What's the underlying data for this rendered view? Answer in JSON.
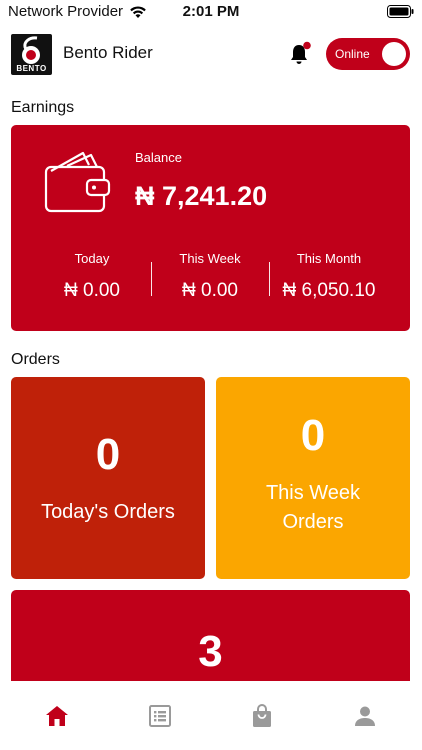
{
  "status_bar": {
    "carrier": "Network Provider",
    "time": "2:01 PM"
  },
  "header": {
    "logo_text": "BENTO",
    "app_title": "Bento Rider",
    "status_toggle_label": "Online",
    "toggle_on": true
  },
  "earnings": {
    "section_title": "Earnings",
    "balance_label": "Balance",
    "balance_value": "₦ 7,241.20",
    "periods": [
      {
        "label": "Today",
        "value": "₦ 0.00"
      },
      {
        "label": "This Week",
        "value": "₦ 0.00"
      },
      {
        "label": "This Month",
        "value": "₦ 6,050.10"
      }
    ]
  },
  "orders": {
    "section_title": "Orders",
    "tiles": [
      {
        "value": "0",
        "label": "Today's Orders",
        "color": "#bf2109"
      },
      {
        "value": "0",
        "label": "This Week Orders",
        "color": "#fba600"
      },
      {
        "value": "3",
        "label": "",
        "color": "#c0001a"
      }
    ]
  },
  "bottom_nav": {
    "items": [
      {
        "icon": "home-icon",
        "active": true
      },
      {
        "icon": "list-icon",
        "active": false
      },
      {
        "icon": "shopping-bag-icon",
        "active": false
      },
      {
        "icon": "person-icon",
        "active": false
      }
    ]
  },
  "colors": {
    "brand_red": "#c0001a",
    "tile_red_orange": "#bf2109",
    "tile_orange": "#fba600",
    "nav_inactive": "#9a9a9a"
  }
}
